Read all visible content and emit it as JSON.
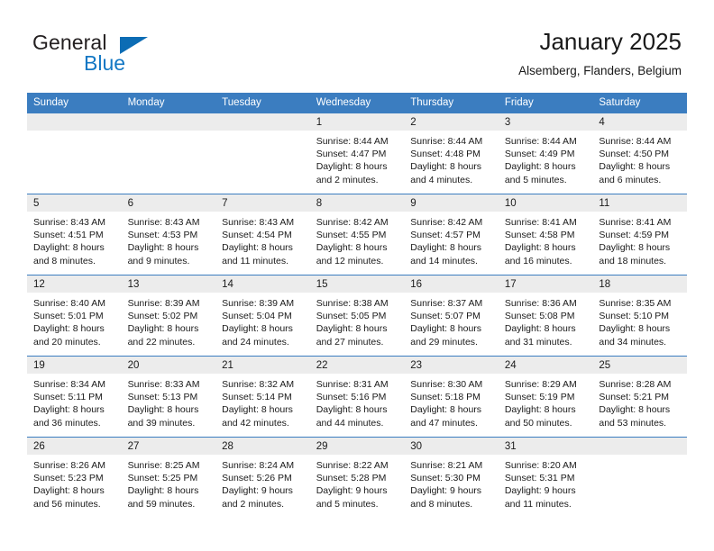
{
  "brand": {
    "name_top": "General",
    "name_bottom": "Blue",
    "triangle_color": "#0c6cb4",
    "blue_text_color": "#1277c4"
  },
  "header": {
    "title": "January 2025",
    "subtitle": "Alsemberg, Flanders, Belgium"
  },
  "theme": {
    "header_blue": "#3b7dc0",
    "daynum_band": "#ececec",
    "text": "#1a1a1a"
  },
  "weekdays": [
    "Sunday",
    "Monday",
    "Tuesday",
    "Wednesday",
    "Thursday",
    "Friday",
    "Saturday"
  ],
  "weeks": [
    [
      {
        "day": "",
        "blank": true,
        "lines": []
      },
      {
        "day": "",
        "blank": true,
        "lines": []
      },
      {
        "day": "",
        "blank": true,
        "lines": []
      },
      {
        "day": "1",
        "blank": false,
        "lines": [
          "Sunrise: 8:44 AM",
          "Sunset: 4:47 PM",
          "Daylight: 8 hours",
          "and 2 minutes."
        ]
      },
      {
        "day": "2",
        "blank": false,
        "lines": [
          "Sunrise: 8:44 AM",
          "Sunset: 4:48 PM",
          "Daylight: 8 hours",
          "and 4 minutes."
        ]
      },
      {
        "day": "3",
        "blank": false,
        "lines": [
          "Sunrise: 8:44 AM",
          "Sunset: 4:49 PM",
          "Daylight: 8 hours",
          "and 5 minutes."
        ]
      },
      {
        "day": "4",
        "blank": false,
        "lines": [
          "Sunrise: 8:44 AM",
          "Sunset: 4:50 PM",
          "Daylight: 8 hours",
          "and 6 minutes."
        ]
      }
    ],
    [
      {
        "day": "5",
        "blank": false,
        "lines": [
          "Sunrise: 8:43 AM",
          "Sunset: 4:51 PM",
          "Daylight: 8 hours",
          "and 8 minutes."
        ]
      },
      {
        "day": "6",
        "blank": false,
        "lines": [
          "Sunrise: 8:43 AM",
          "Sunset: 4:53 PM",
          "Daylight: 8 hours",
          "and 9 minutes."
        ]
      },
      {
        "day": "7",
        "blank": false,
        "lines": [
          "Sunrise: 8:43 AM",
          "Sunset: 4:54 PM",
          "Daylight: 8 hours",
          "and 11 minutes."
        ]
      },
      {
        "day": "8",
        "blank": false,
        "lines": [
          "Sunrise: 8:42 AM",
          "Sunset: 4:55 PM",
          "Daylight: 8 hours",
          "and 12 minutes."
        ]
      },
      {
        "day": "9",
        "blank": false,
        "lines": [
          "Sunrise: 8:42 AM",
          "Sunset: 4:57 PM",
          "Daylight: 8 hours",
          "and 14 minutes."
        ]
      },
      {
        "day": "10",
        "blank": false,
        "lines": [
          "Sunrise: 8:41 AM",
          "Sunset: 4:58 PM",
          "Daylight: 8 hours",
          "and 16 minutes."
        ]
      },
      {
        "day": "11",
        "blank": false,
        "lines": [
          "Sunrise: 8:41 AM",
          "Sunset: 4:59 PM",
          "Daylight: 8 hours",
          "and 18 minutes."
        ]
      }
    ],
    [
      {
        "day": "12",
        "blank": false,
        "lines": [
          "Sunrise: 8:40 AM",
          "Sunset: 5:01 PM",
          "Daylight: 8 hours",
          "and 20 minutes."
        ]
      },
      {
        "day": "13",
        "blank": false,
        "lines": [
          "Sunrise: 8:39 AM",
          "Sunset: 5:02 PM",
          "Daylight: 8 hours",
          "and 22 minutes."
        ]
      },
      {
        "day": "14",
        "blank": false,
        "lines": [
          "Sunrise: 8:39 AM",
          "Sunset: 5:04 PM",
          "Daylight: 8 hours",
          "and 24 minutes."
        ]
      },
      {
        "day": "15",
        "blank": false,
        "lines": [
          "Sunrise: 8:38 AM",
          "Sunset: 5:05 PM",
          "Daylight: 8 hours",
          "and 27 minutes."
        ]
      },
      {
        "day": "16",
        "blank": false,
        "lines": [
          "Sunrise: 8:37 AM",
          "Sunset: 5:07 PM",
          "Daylight: 8 hours",
          "and 29 minutes."
        ]
      },
      {
        "day": "17",
        "blank": false,
        "lines": [
          "Sunrise: 8:36 AM",
          "Sunset: 5:08 PM",
          "Daylight: 8 hours",
          "and 31 minutes."
        ]
      },
      {
        "day": "18",
        "blank": false,
        "lines": [
          "Sunrise: 8:35 AM",
          "Sunset: 5:10 PM",
          "Daylight: 8 hours",
          "and 34 minutes."
        ]
      }
    ],
    [
      {
        "day": "19",
        "blank": false,
        "lines": [
          "Sunrise: 8:34 AM",
          "Sunset: 5:11 PM",
          "Daylight: 8 hours",
          "and 36 minutes."
        ]
      },
      {
        "day": "20",
        "blank": false,
        "lines": [
          "Sunrise: 8:33 AM",
          "Sunset: 5:13 PM",
          "Daylight: 8 hours",
          "and 39 minutes."
        ]
      },
      {
        "day": "21",
        "blank": false,
        "lines": [
          "Sunrise: 8:32 AM",
          "Sunset: 5:14 PM",
          "Daylight: 8 hours",
          "and 42 minutes."
        ]
      },
      {
        "day": "22",
        "blank": false,
        "lines": [
          "Sunrise: 8:31 AM",
          "Sunset: 5:16 PM",
          "Daylight: 8 hours",
          "and 44 minutes."
        ]
      },
      {
        "day": "23",
        "blank": false,
        "lines": [
          "Sunrise: 8:30 AM",
          "Sunset: 5:18 PM",
          "Daylight: 8 hours",
          "and 47 minutes."
        ]
      },
      {
        "day": "24",
        "blank": false,
        "lines": [
          "Sunrise: 8:29 AM",
          "Sunset: 5:19 PM",
          "Daylight: 8 hours",
          "and 50 minutes."
        ]
      },
      {
        "day": "25",
        "blank": false,
        "lines": [
          "Sunrise: 8:28 AM",
          "Sunset: 5:21 PM",
          "Daylight: 8 hours",
          "and 53 minutes."
        ]
      }
    ],
    [
      {
        "day": "26",
        "blank": false,
        "lines": [
          "Sunrise: 8:26 AM",
          "Sunset: 5:23 PM",
          "Daylight: 8 hours",
          "and 56 minutes."
        ]
      },
      {
        "day": "27",
        "blank": false,
        "lines": [
          "Sunrise: 8:25 AM",
          "Sunset: 5:25 PM",
          "Daylight: 8 hours",
          "and 59 minutes."
        ]
      },
      {
        "day": "28",
        "blank": false,
        "lines": [
          "Sunrise: 8:24 AM",
          "Sunset: 5:26 PM",
          "Daylight: 9 hours",
          "and 2 minutes."
        ]
      },
      {
        "day": "29",
        "blank": false,
        "lines": [
          "Sunrise: 8:22 AM",
          "Sunset: 5:28 PM",
          "Daylight: 9 hours",
          "and 5 minutes."
        ]
      },
      {
        "day": "30",
        "blank": false,
        "lines": [
          "Sunrise: 8:21 AM",
          "Sunset: 5:30 PM",
          "Daylight: 9 hours",
          "and 8 minutes."
        ]
      },
      {
        "day": "31",
        "blank": false,
        "lines": [
          "Sunrise: 8:20 AM",
          "Sunset: 5:31 PM",
          "Daylight: 9 hours",
          "and 11 minutes."
        ]
      },
      {
        "day": "",
        "blank": true,
        "lines": []
      }
    ]
  ]
}
